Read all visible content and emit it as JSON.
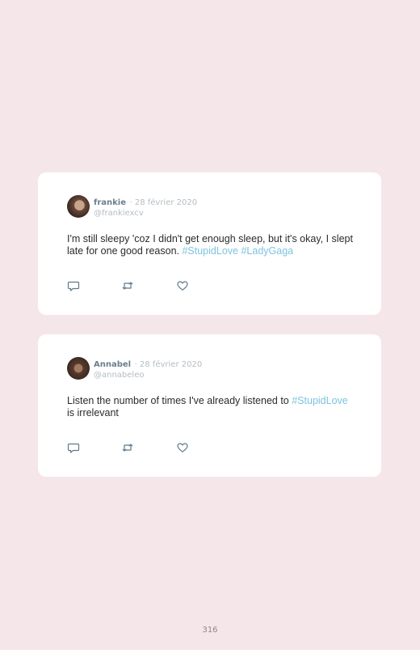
{
  "colors": {
    "page_background": "#f4e6e9",
    "card_background": "#ffffff",
    "name": "#6a7f8e",
    "meta": "#b5bdc3",
    "hashtag": "#7cc4df",
    "icon": "#5d7a8c"
  },
  "tweets": [
    {
      "name": "frankie",
      "date": "· 28 février 2020",
      "handle": "@frankiexcv",
      "text_before": "I'm still sleepy 'coz I didn't get enough sleep, but it's okay, I slept late for one good reason. ",
      "hashtag_1": "#StupidLove",
      "between": " ",
      "hashtag_2": "#LadyGaga",
      "text_after": "",
      "icons": [
        "reply-icon",
        "retweet-icon",
        "like-icon"
      ]
    },
    {
      "name": "Annabel",
      "date": "· 28 février 2020",
      "handle": "@annabeleo",
      "text_before": "Listen the number of times I've already listened to ",
      "hashtag_1": "#StupidLove",
      "between": "",
      "hashtag_2": "",
      "text_after": " is irrelevant",
      "icons": [
        "reply-icon",
        "retweet-icon",
        "like-icon"
      ]
    }
  ],
  "page_number": "316"
}
